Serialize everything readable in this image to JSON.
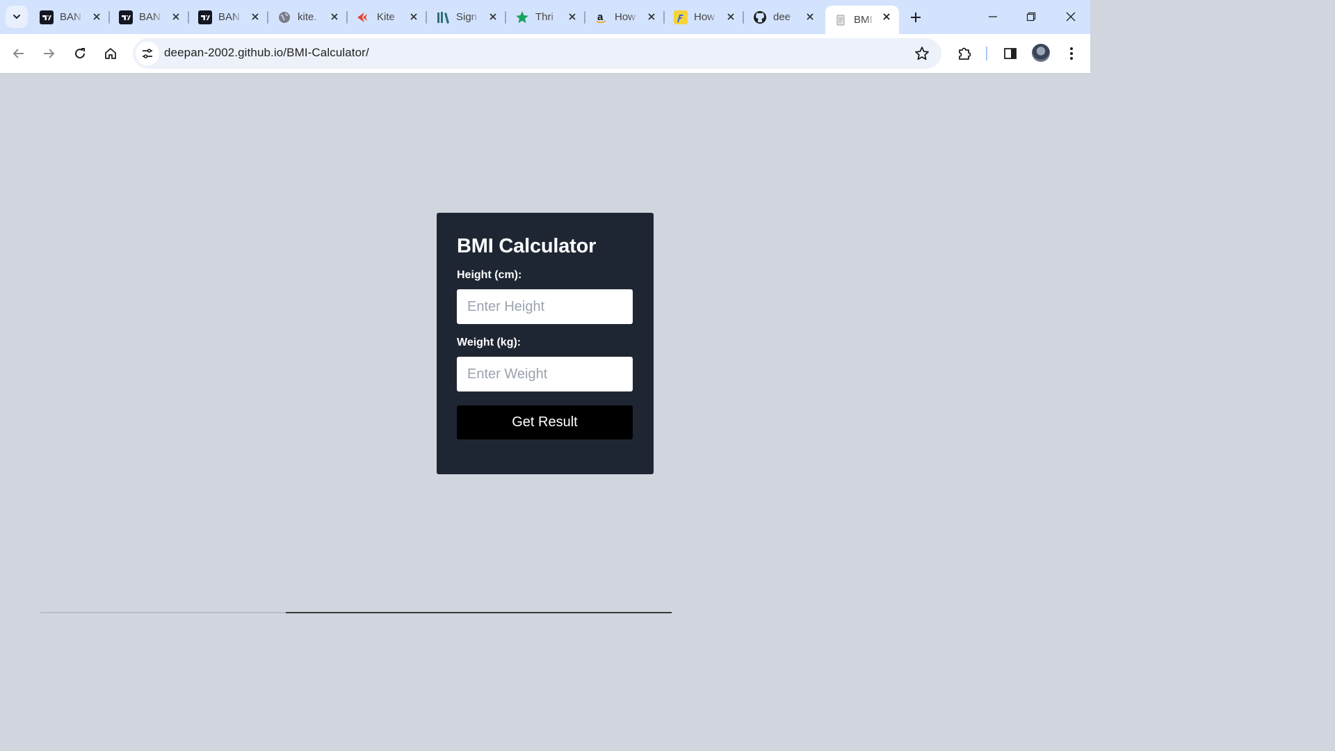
{
  "browser": {
    "tabs": [
      {
        "title": "BAN",
        "icon": "tradingview-icon",
        "active": false
      },
      {
        "title": "BAN",
        "icon": "tradingview-icon",
        "active": false
      },
      {
        "title": "BAN",
        "icon": "tradingview-icon",
        "active": false
      },
      {
        "title": "kite.",
        "icon": "globe-icon",
        "active": false
      },
      {
        "title": "Kite",
        "icon": "kite-icon",
        "active": false
      },
      {
        "title": "Sign",
        "icon": "books-icon",
        "active": false
      },
      {
        "title": "Thri",
        "icon": "star-icon",
        "active": false
      },
      {
        "title": "How",
        "icon": "amazon-icon",
        "active": false
      },
      {
        "title": "How",
        "icon": "flipkart-icon",
        "active": false
      },
      {
        "title": "dee",
        "icon": "github-icon",
        "active": false
      },
      {
        "title": "BMI",
        "icon": "page-icon",
        "active": true
      }
    ],
    "url": "deepan-2002.github.io/BMI-Calculator/"
  },
  "page": {
    "title": "BMI Calculator",
    "height_label": "Height (cm):",
    "height_placeholder": "Enter Height",
    "weight_label": "Weight (kg):",
    "weight_placeholder": "Enter Weight",
    "submit_label": "Get Result"
  },
  "colors": {
    "tabstrip": "#d3e3fd",
    "page_background": "#d1d5de",
    "card_background": "#1f2633",
    "button_background": "#000000"
  }
}
